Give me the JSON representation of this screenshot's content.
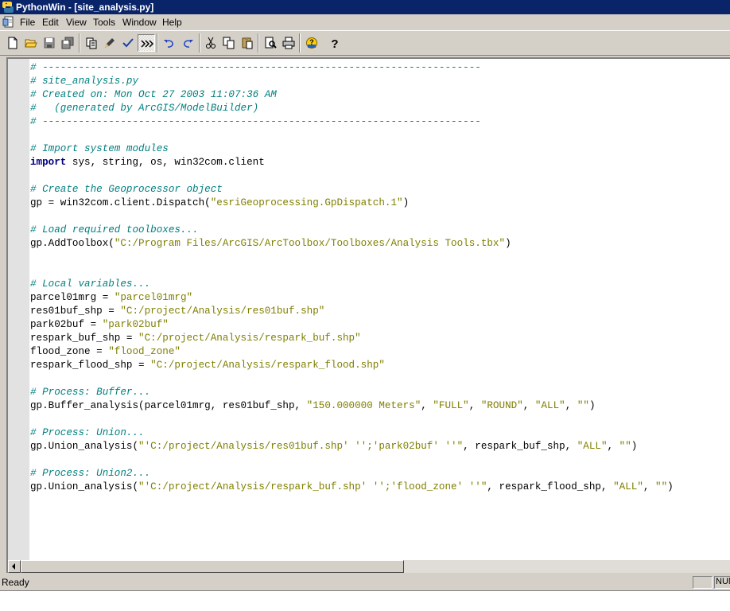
{
  "window": {
    "title": "PythonWin - [site_analysis.py]"
  },
  "menu": [
    "File",
    "Edit",
    "View",
    "Tools",
    "Window",
    "Help"
  ],
  "toolbar": {
    "buttons": [
      "new-file",
      "open-file",
      "save",
      "save-all",
      "copy-format",
      "pencil",
      "checkmark",
      "run-script",
      "undo",
      "redo",
      "cut",
      "copy",
      "paste",
      "print-preview",
      "print",
      "help-context",
      "help"
    ]
  },
  "editor": {
    "lines": [
      [
        {
          "t": "# -------------------------------------------------------------------------",
          "c": "comment"
        }
      ],
      [
        {
          "t": "# site_analysis.py",
          "c": "comment"
        }
      ],
      [
        {
          "t": "# Created on: Mon Oct 27 2003 11:07:36 AM",
          "c": "comment"
        }
      ],
      [
        {
          "t": "#   (generated by ArcGIS/ModelBuilder)",
          "c": "comment"
        }
      ],
      [
        {
          "t": "# -------------------------------------------------------------------------",
          "c": "comment"
        }
      ],
      [],
      [
        {
          "t": "# Import system modules",
          "c": "comment"
        }
      ],
      [
        {
          "t": "import",
          "c": "kw"
        },
        {
          "t": " sys, string, os, win32com.client",
          "c": "plain"
        }
      ],
      [],
      [
        {
          "t": "# Create the Geoprocessor object",
          "c": "comment"
        }
      ],
      [
        {
          "t": "gp = win32com.client.Dispatch(",
          "c": "plain"
        },
        {
          "t": "\"esriGeoprocessing.GpDispatch.1\"",
          "c": "str"
        },
        {
          "t": ")",
          "c": "plain"
        }
      ],
      [],
      [
        {
          "t": "# Load required toolboxes...",
          "c": "comment"
        }
      ],
      [
        {
          "t": "gp.AddToolbox(",
          "c": "plain"
        },
        {
          "t": "\"C:/Program Files/ArcGIS/ArcToolbox/Toolboxes/Analysis Tools.tbx\"",
          "c": "str"
        },
        {
          "t": ")",
          "c": "plain"
        }
      ],
      [],
      [],
      [
        {
          "t": "# Local variables...",
          "c": "comment"
        }
      ],
      [
        {
          "t": "parcel01mrg = ",
          "c": "plain"
        },
        {
          "t": "\"parcel01mrg\"",
          "c": "str"
        }
      ],
      [
        {
          "t": "res01buf_shp = ",
          "c": "plain"
        },
        {
          "t": "\"C:/project/Analysis/res01buf.shp\"",
          "c": "str"
        }
      ],
      [
        {
          "t": "park02buf = ",
          "c": "plain"
        },
        {
          "t": "\"park02buf\"",
          "c": "str"
        }
      ],
      [
        {
          "t": "respark_buf_shp = ",
          "c": "plain"
        },
        {
          "t": "\"C:/project/Analysis/respark_buf.shp\"",
          "c": "str"
        }
      ],
      [
        {
          "t": "flood_zone = ",
          "c": "plain"
        },
        {
          "t": "\"flood_zone\"",
          "c": "str"
        }
      ],
      [
        {
          "t": "respark_flood_shp = ",
          "c": "plain"
        },
        {
          "t": "\"C:/project/Analysis/respark_flood.shp\"",
          "c": "str"
        }
      ],
      [],
      [
        {
          "t": "# Process: Buffer...",
          "c": "comment"
        }
      ],
      [
        {
          "t": "gp.Buffer_analysis(parcel01mrg, res01buf_shp, ",
          "c": "plain"
        },
        {
          "t": "\"150.000000 Meters\"",
          "c": "str"
        },
        {
          "t": ", ",
          "c": "plain"
        },
        {
          "t": "\"FULL\"",
          "c": "str"
        },
        {
          "t": ", ",
          "c": "plain"
        },
        {
          "t": "\"ROUND\"",
          "c": "str"
        },
        {
          "t": ", ",
          "c": "plain"
        },
        {
          "t": "\"ALL\"",
          "c": "str"
        },
        {
          "t": ", ",
          "c": "plain"
        },
        {
          "t": "\"\"",
          "c": "str"
        },
        {
          "t": ")",
          "c": "plain"
        }
      ],
      [],
      [
        {
          "t": "# Process: Union...",
          "c": "comment"
        }
      ],
      [
        {
          "t": "gp.Union_analysis(",
          "c": "plain"
        },
        {
          "t": "\"'C:/project/Analysis/res01buf.shp' '';'park02buf' ''\"",
          "c": "str"
        },
        {
          "t": ", respark_buf_shp, ",
          "c": "plain"
        },
        {
          "t": "\"ALL\"",
          "c": "str"
        },
        {
          "t": ", ",
          "c": "plain"
        },
        {
          "t": "\"\"",
          "c": "str"
        },
        {
          "t": ")",
          "c": "plain"
        }
      ],
      [],
      [
        {
          "t": "# Process: Union2...",
          "c": "comment"
        }
      ],
      [
        {
          "t": "gp.Union_analysis(",
          "c": "plain"
        },
        {
          "t": "\"'C:/project/Analysis/respark_buf.shp' '';'flood_zone' ''\"",
          "c": "str"
        },
        {
          "t": ", respark_flood_shp, ",
          "c": "plain"
        },
        {
          "t": "\"ALL\"",
          "c": "str"
        },
        {
          "t": ", ",
          "c": "plain"
        },
        {
          "t": "\"\"",
          "c": "str"
        },
        {
          "t": ")",
          "c": "plain"
        }
      ]
    ]
  },
  "statusbar": {
    "text": "Ready",
    "num_indicator": "NUM"
  },
  "colors": {
    "title_bar": "#0a246a",
    "comment": "#007f7f",
    "string": "#7f7f00",
    "keyword": "#00007f",
    "chrome": "#d4d0c8"
  }
}
